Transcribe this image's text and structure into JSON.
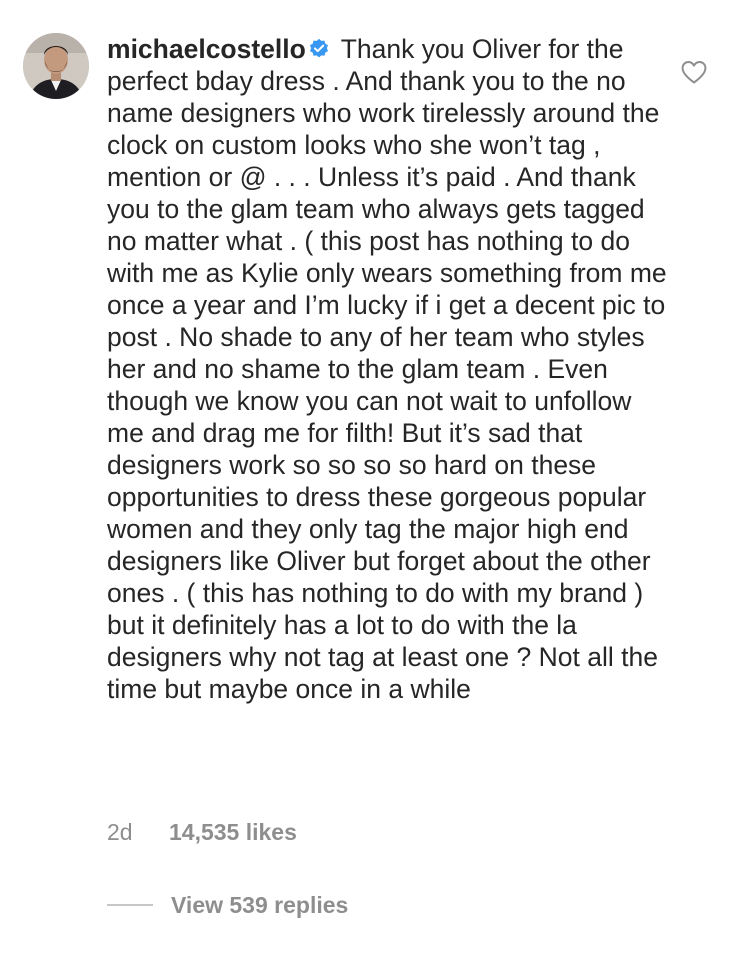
{
  "comment": {
    "avatar_icon": "profile-photo",
    "username": "michaelcostello",
    "verified_icon": "verified-badge-icon",
    "verified_color": "#3897f0",
    "text": " Thank you Oliver for the perfect bday dress .  And thank you to the no name designers who work tirelessly around the clock on custom looks who she won’t tag , mention or @ . . . Unless it’s paid . And thank you to the glam team who always gets tagged no matter what . ( this post has nothing to do with me as Kylie only wears something from me once a year and I’m lucky if i get a decent pic to post . No shade to any of her team who styles her and no shame to the glam team . Even though we know you can not wait to unfollow me and drag me for filth! But it’s sad that designers work so so so so hard on these opportunities to dress these gorgeous popular women and they only tag the major high end designers like Oliver but forget about the other ones . ( this has nothing to do with my brand ) but it definitely has a lot to do with the la designers why not tag at least one ? Not all the time but maybe once in a while",
    "time": "2d",
    "likes": "14,535 likes",
    "like_icon": "heart-outline-icon",
    "view_replies": "View 539 replies"
  }
}
